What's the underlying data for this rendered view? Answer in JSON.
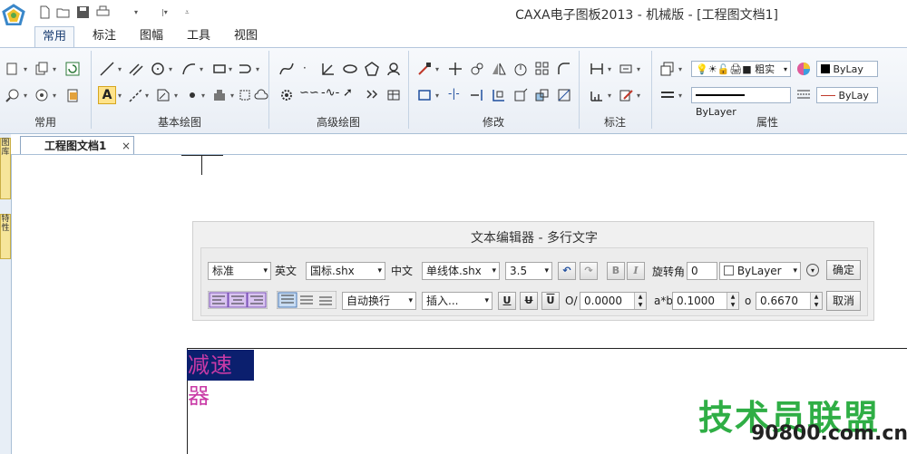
{
  "window": {
    "title": "CAXA电子图板2013 - 机械版 - [工程图文档1]"
  },
  "quick_access": {
    "icons": [
      "new-file-icon",
      "open-folder-icon",
      "save-icon",
      "print-icon",
      "dropdown-icon",
      "dropdown-icon",
      "customize-icon"
    ]
  },
  "tabs": [
    {
      "label": "常用",
      "active": true
    },
    {
      "label": "标注"
    },
    {
      "label": "图幅"
    },
    {
      "label": "工具"
    },
    {
      "label": "视图"
    }
  ],
  "ribbon": {
    "groups": [
      {
        "label": "常用"
      },
      {
        "label": "基本绘图"
      },
      {
        "label": "高级绘图"
      },
      {
        "label": "修改"
      },
      {
        "label": "标注"
      },
      {
        "label": "属性"
      }
    ],
    "properties": {
      "layer_label": "粗实",
      "color_label": "ByLay",
      "linetype_label": "ByLayer",
      "linewidth_label": "ByLay"
    }
  },
  "document_tab": {
    "label": "工程图文档1",
    "close": "×"
  },
  "side_panel": {
    "tab1": "图库",
    "tab2": "特性"
  },
  "text_editor": {
    "title": "文本编辑器 - 多行文字",
    "row1": {
      "style": "标准",
      "english_label": "英文",
      "english_font": "国标.shx",
      "chinese_label": "中文",
      "chinese_font": "单线体.shx",
      "height": "3.5",
      "bold": "B",
      "italic": "I",
      "rotation_label": "旋转角",
      "rotation": "0",
      "color": "ByLayer",
      "ok": "确定"
    },
    "row2": {
      "wrap": "自动换行",
      "insert": "插入...",
      "underline": "U",
      "strike": "U",
      "overline": "U",
      "oblique_label": "O/",
      "oblique": "0.0000",
      "spacing_label": "a*b",
      "spacing": "0.1000",
      "ratio_label": "o",
      "ratio": "0.6670",
      "cancel": "取消"
    }
  },
  "canvas": {
    "selected_text": "减速器"
  },
  "watermark": {
    "line1": "技术员联盟",
    "line2": "90800.com.cn"
  }
}
